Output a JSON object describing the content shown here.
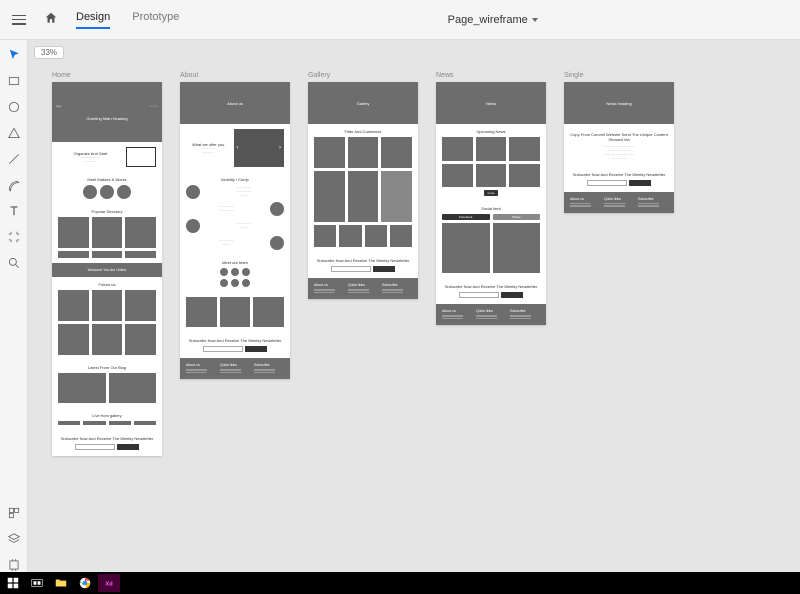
{
  "app": {
    "file_name": "Page_wireframe",
    "zoom": "33%"
  },
  "tabs": {
    "design": "Design",
    "prototype": "Prototype"
  },
  "tools": {
    "select": "select",
    "rect": "rectangle",
    "ellipse": "ellipse",
    "polygon": "polygon",
    "line": "line",
    "pen": "pen",
    "text": "text",
    "artboard": "artboard",
    "zoom": "zoom",
    "assets": "assets",
    "layers": "layers",
    "plugins": "plugins"
  },
  "artboards": [
    {
      "name": "Home",
      "hero_title": "Greeting\nMain Heading",
      "sections": {
        "s1": "Organize And Start",
        "s2": "Meet Makers & Works",
        "s3": "Popular Directory",
        "banner": "Welcome\nYou Are Online",
        "s4": "Follow us",
        "s5": "Latest From Our Blog",
        "s6": "Live from gallery"
      }
    },
    {
      "name": "About",
      "hero_title": "About us",
      "sections": {
        "s1": "What we offer you",
        "s2": "Mobility / Comp",
        "s3": "Meet our team"
      }
    },
    {
      "name": "Gallery",
      "hero_title": "Gallery",
      "sections": {
        "s1": "Filter And Customize"
      }
    },
    {
      "name": "News",
      "hero_title": "News",
      "sections": {
        "s1": "Upcoming News",
        "s2": "Social feed",
        "fb": "Facebook",
        "tw": "Twitter"
      }
    },
    {
      "name": "Single",
      "hero_title": "News heading",
      "sections": {
        "body": "Copy From Commit Website Send The Unique Content Showed Via"
      }
    }
  ],
  "news": {
    "title": "Subscribe Now And Receive The Weekly Newsletter"
  },
  "footer": {
    "c1": "About us",
    "c2": "Quick links",
    "c3": "Subscribe"
  },
  "taskbar": {
    "start": "start",
    "search": "search",
    "files": "file-explorer",
    "chrome": "chrome",
    "xd": "adobe-xd"
  }
}
